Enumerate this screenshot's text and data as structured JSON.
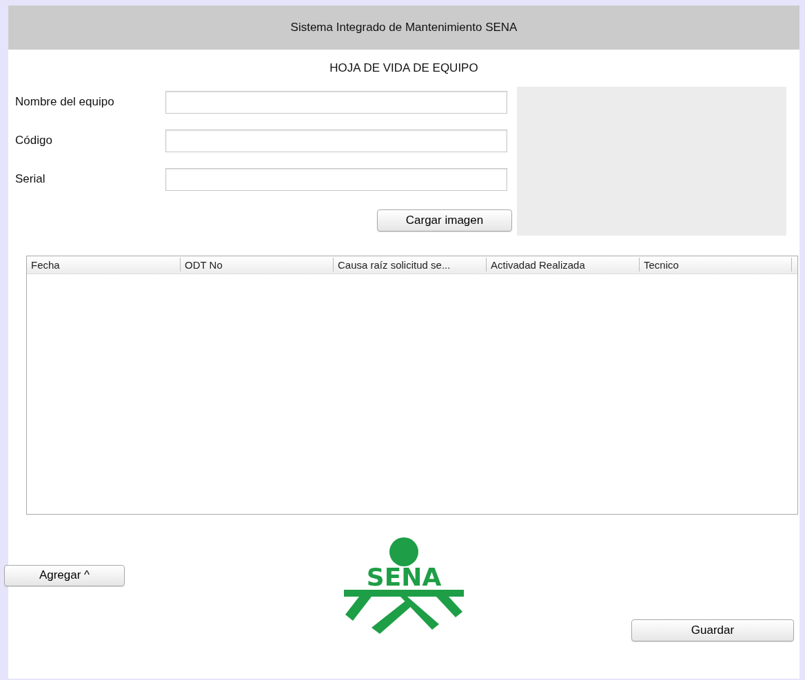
{
  "window": {
    "title": "Sistema Integrado de Mantenimiento SENA"
  },
  "heading": "HOJA DE VIDA DE EQUIPO",
  "fields": [
    {
      "label": "Nombre del equipo"
    },
    {
      "label": "Código"
    },
    {
      "label": "Serial"
    }
  ],
  "load_image_button": "Cargar imagen",
  "table": {
    "columns": [
      "Fecha",
      "ODT No",
      "Causa raíz solicitud se...",
      "Activadad Realizada",
      "Tecnico"
    ]
  },
  "logo": {
    "text": "SENA"
  },
  "buttons": {
    "add": "Agregar ^",
    "save": "Guardar"
  }
}
